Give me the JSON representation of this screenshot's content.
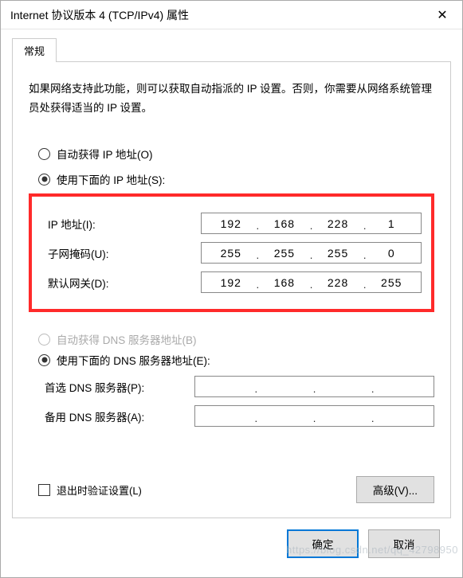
{
  "window": {
    "title": "Internet 协议版本 4 (TCP/IPv4) 属性",
    "close": "✕"
  },
  "tab": {
    "label": "常规"
  },
  "description": "如果网络支持此功能，则可以获取自动指派的 IP 设置。否则，你需要从网络系统管理员处获得适当的 IP 设置。",
  "ip_section": {
    "auto_label": "自动获得 IP 地址(O)",
    "manual_label": "使用下面的 IP 地址(S):",
    "fields": {
      "ip": {
        "label": "IP 地址(I):",
        "octets": [
          "192",
          "168",
          "228",
          "1"
        ]
      },
      "subnet": {
        "label": "子网掩码(U):",
        "octets": [
          "255",
          "255",
          "255",
          "0"
        ]
      },
      "gateway": {
        "label": "默认网关(D):",
        "octets": [
          "192",
          "168",
          "228",
          "255"
        ]
      }
    }
  },
  "dns_section": {
    "auto_label": "自动获得 DNS 服务器地址(B)",
    "manual_label": "使用下面的 DNS 服务器地址(E):",
    "fields": {
      "preferred": {
        "label": "首选 DNS 服务器(P):",
        "octets": [
          "",
          "",
          "",
          ""
        ]
      },
      "alternate": {
        "label": "备用 DNS 服务器(A):",
        "octets": [
          "",
          "",
          "",
          ""
        ]
      }
    }
  },
  "validate_checkbox": "退出时验证设置(L)",
  "buttons": {
    "advanced": "高级(V)...",
    "ok": "确定",
    "cancel": "取消"
  },
  "watermark": "https://blog.csdn.net/qq_42798950"
}
